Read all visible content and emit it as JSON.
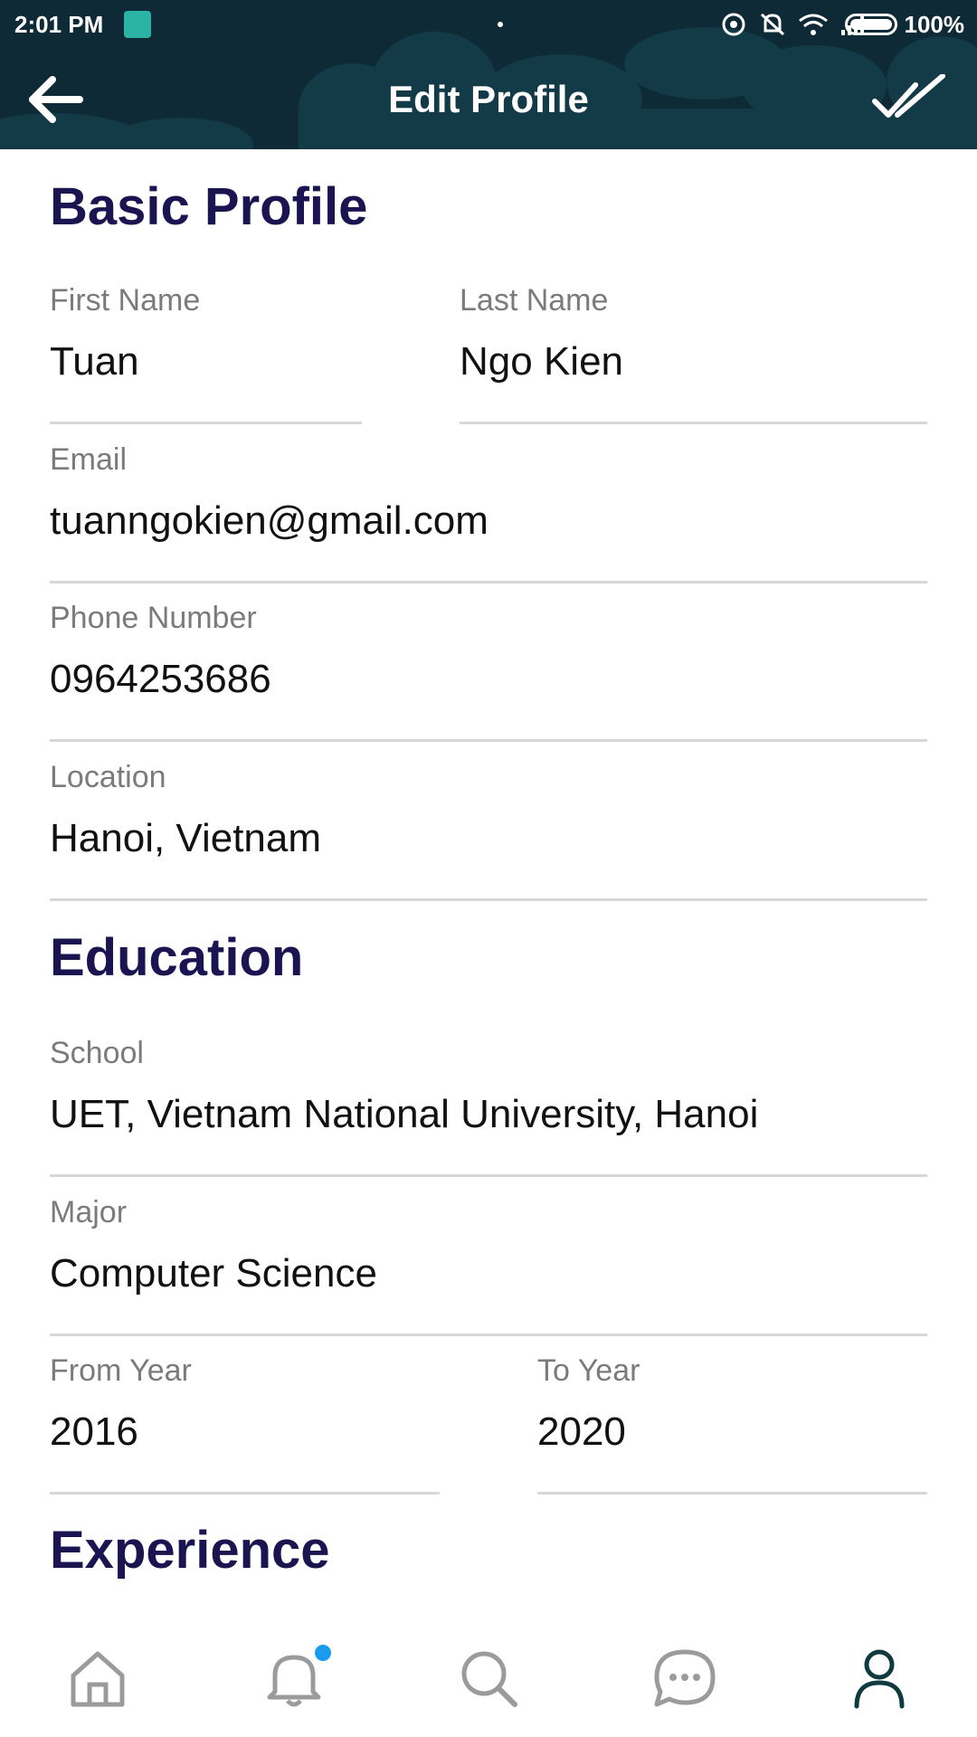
{
  "status_bar": {
    "time": "2:01 PM",
    "battery": "100%"
  },
  "header": {
    "title": "Edit Profile",
    "back_icon": "arrow-left-icon",
    "confirm_icon": "double-check-icon"
  },
  "basic_profile": {
    "section_title": "Basic Profile",
    "first_name": {
      "label": "First Name",
      "value": "Tuan"
    },
    "last_name": {
      "label": "Last Name",
      "value": "Ngo Kien"
    },
    "email": {
      "label": "Email",
      "value": "tuanngokien@gmail.com"
    },
    "phone": {
      "label": "Phone Number",
      "value": "0964253686"
    },
    "location": {
      "label": "Location",
      "value": "Hanoi, Vietnam"
    }
  },
  "education": {
    "section_title": "Education",
    "school": {
      "label": "School",
      "value": "UET, Vietnam National University, Hanoi"
    },
    "major": {
      "label": "Major",
      "value": "Computer Science"
    },
    "from_year": {
      "label": "From Year",
      "value": "2016"
    },
    "to_year": {
      "label": "To Year",
      "value": "2020"
    }
  },
  "experience": {
    "section_title": "Experience"
  },
  "bottom_nav": {
    "items": [
      "home-icon",
      "bell-icon",
      "search-icon",
      "chat-icon",
      "profile-icon"
    ],
    "active": "profile-icon",
    "colors": {
      "active": "#0e3a40",
      "inactive": "#9b9b9b",
      "notification": "#1a9bf0"
    }
  }
}
